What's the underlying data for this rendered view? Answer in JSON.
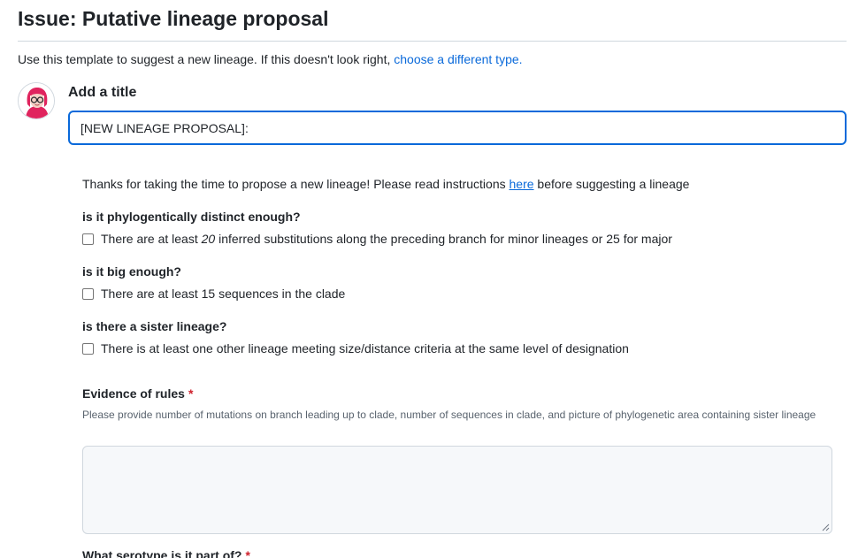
{
  "page": {
    "title": "Issue: Putative lineage proposal",
    "intro_text": "Use this template to suggest a new lineage. If this doesn't look right, ",
    "intro_link": "choose a different type."
  },
  "title_field": {
    "label": "Add a title",
    "value": "[NEW LINEAGE PROPOSAL]: "
  },
  "form": {
    "thanks_prefix": "Thanks for taking the time to propose a new lineage! Please read instructions ",
    "thanks_link": "here",
    "thanks_suffix": " before suggesting a lineage",
    "questions": [
      {
        "heading": "is it phylogentically distinct enough?",
        "check_pre": "There are at least ",
        "check_em": "20",
        "check_post": " inferred substitutions along the preceding branch for minor lineages or 25 for major",
        "checked": false
      },
      {
        "heading": "is it big enough?",
        "check_text": "There are at least 15 sequences in the clade",
        "checked": false
      },
      {
        "heading": "is there a sister lineage?",
        "check_text": "There is at least one other lineage meeting size/distance criteria at the same level of designation",
        "checked": false
      }
    ],
    "evidence": {
      "label": "Evidence of rules",
      "required_mark": "*",
      "help": "Please provide number of mutations on branch leading up to clade, number of sequences in clade, and picture of phylogenetic area containing sister lineage",
      "value": ""
    },
    "next_field": {
      "label": "What serotype is it part of?",
      "required_mark": "*"
    }
  },
  "colors": {
    "accent": "#0969da",
    "required": "#cf222e",
    "avatar_hair": "#e0245e"
  },
  "icons": {
    "avatar": "user-avatar-icon",
    "resize": "resize-handle-icon"
  }
}
